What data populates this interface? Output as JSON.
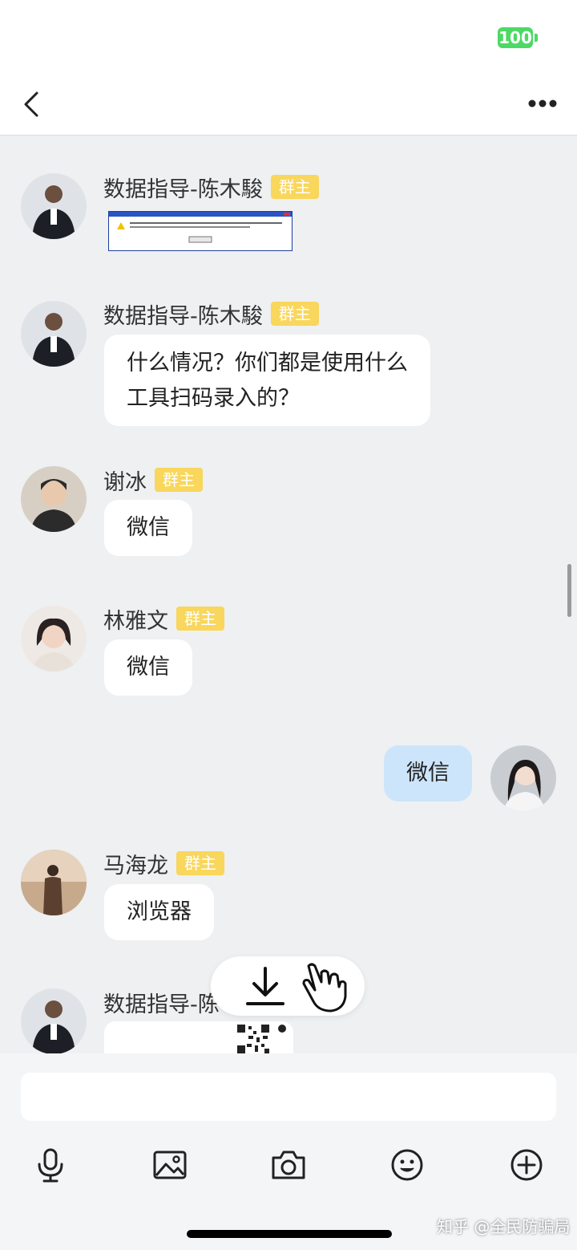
{
  "status_bar": {
    "battery": "100"
  },
  "messages": [
    {
      "sender": "数据指导-陈木駿",
      "badge": "群主",
      "type": "image"
    },
    {
      "sender": "数据指导-陈木駿",
      "badge": "群主",
      "line1": "什么情况？你们都是使用什么",
      "line2": "工具扫码录入的？"
    },
    {
      "sender": "谢冰",
      "badge": "群主",
      "text": "微信"
    },
    {
      "sender": "林雅文",
      "badge": "群主",
      "text": "微信"
    },
    {
      "sender": "me",
      "text": "微信"
    },
    {
      "sender": "马海龙",
      "badge": "群主",
      "text": "浏览器"
    },
    {
      "sender": "数据指导-陈",
      "type": "qr-image"
    }
  ],
  "watermark": "知乎 @全民防骗局",
  "icons": {
    "back": "chevron-left-icon",
    "more": "more-dots-icon",
    "download": "download-icon",
    "hand": "hand-pointer-icon",
    "voice": "microphone-icon",
    "image": "image-icon",
    "camera": "camera-icon",
    "emoji": "emoji-icon",
    "plus": "plus-circle-icon"
  },
  "colors": {
    "badge": "#f9d65c",
    "my_bubble": "#cde5fa",
    "battery": "#4cd964"
  }
}
